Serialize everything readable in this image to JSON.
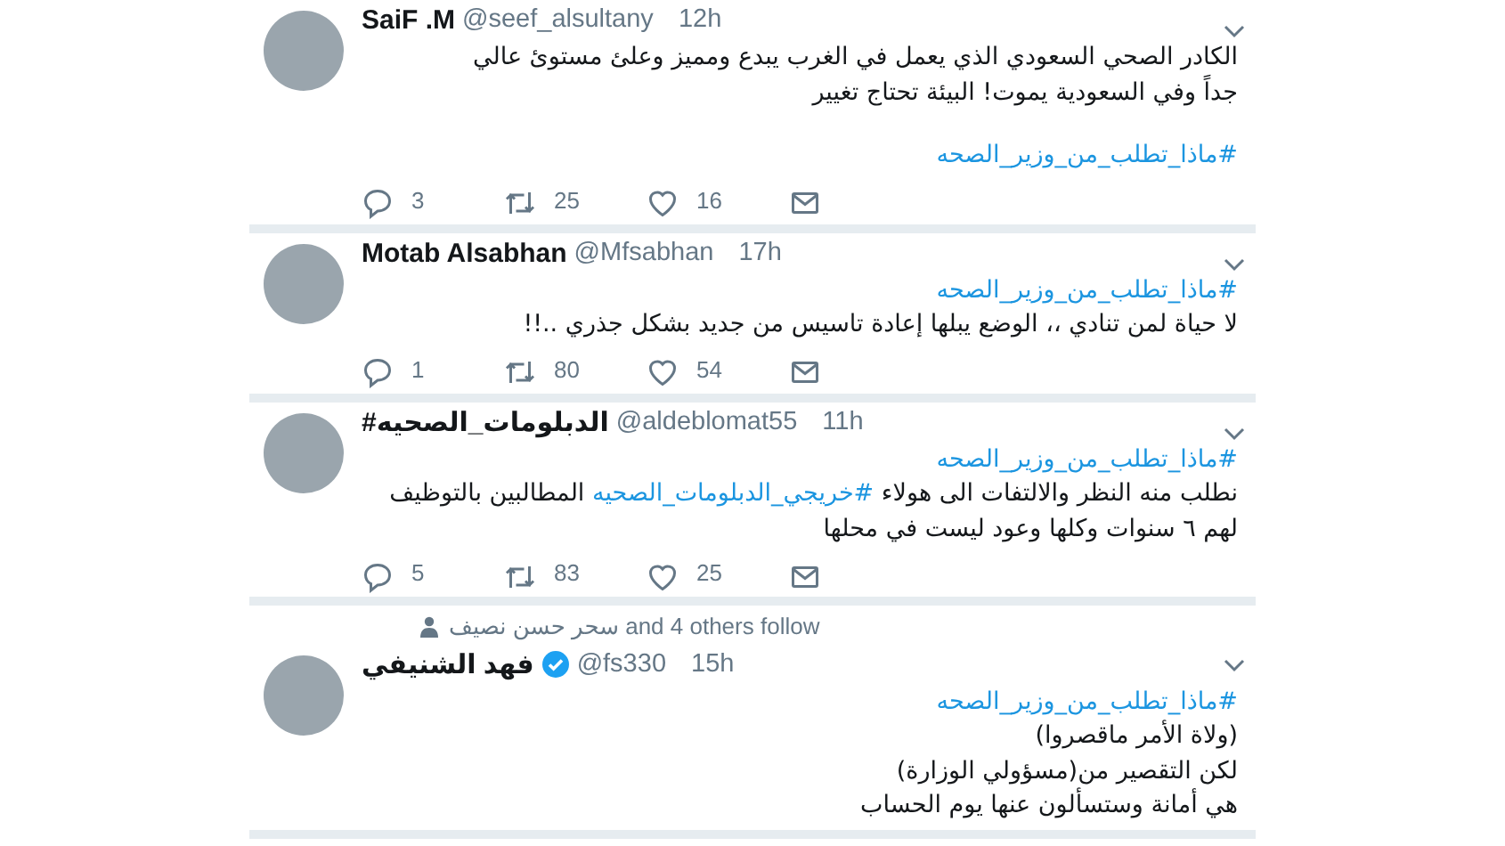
{
  "tweets": [
    {
      "name": "SaiF .M",
      "verified": false,
      "handle": "@seef_alsultany",
      "time": "12h",
      "body": [
        [
          [
            {
              "kind": "text",
              "text": "الكادر الصحي السعودي الذي يعمل في الغرب يبدع ومميز وعلئ مستوئ عالي"
            }
          ],
          [
            {
              "kind": "text",
              "text": "جداً وفي السعودية يموت! البيئة تحتاج تغيير"
            }
          ]
        ],
        [
          [
            {
              "kind": "hashtag",
              "text": "#ماذا_تطلب_من_وزير_الصحه"
            }
          ]
        ]
      ],
      "actions": {
        "replies": "3",
        "retweets": "25",
        "likes": "16"
      }
    },
    {
      "name": "Motab Alsabhan",
      "verified": false,
      "handle": "@Mfsabhan",
      "time": "17h",
      "body": [
        [
          [
            {
              "kind": "hashtag",
              "text": "#ماذا_تطلب_من_وزير_الصحه"
            }
          ],
          [
            {
              "kind": "text",
              "text": "لا حياة لمن تنادي ،، الوضع يبلها إعادة تاسيس من جديد بشكل جذري ..!!"
            }
          ]
        ]
      ],
      "actions": {
        "replies": "1",
        "retweets": "80",
        "likes": "54"
      }
    },
    {
      "name": "#الدبلومات_الصحيه",
      "verified": false,
      "handle": "@aldeblomat55",
      "time": "11h",
      "body": [
        [
          [
            {
              "kind": "hashtag",
              "text": "#ماذا_تطلب_من_وزير_الصحه"
            }
          ],
          [
            {
              "kind": "text",
              "text": "نطلب منه النظر والالتفات الى هولاء "
            },
            {
              "kind": "hashtag",
              "text": "#خريجي_الدبلومات_الصحيه"
            },
            {
              "kind": "text",
              "text": " المطالبين بالتوظيف"
            }
          ],
          [
            {
              "kind": "text",
              "text": "لهم ٦ سنوات وكلها وعود ليست في محلها"
            }
          ]
        ]
      ],
      "actions": {
        "replies": "5",
        "retweets": "83",
        "likes": "25"
      }
    },
    {
      "social_context": "سحر حسن نصيف and 4 others follow",
      "name": "فهد الشنيفي",
      "verified": true,
      "handle": "@fs330",
      "time": "15h",
      "body": [
        [
          [
            {
              "kind": "hashtag",
              "text": "#ماذا_تطلب_من_وزير_الصحه"
            }
          ],
          [
            {
              "kind": "text",
              "text": "(ولاة الأمر ماقصروا)"
            }
          ],
          [
            {
              "kind": "text",
              "text": "لكن التقصير من(مسؤولي الوزارة)"
            }
          ],
          [
            {
              "kind": "text",
              "text": "هي أمانة وستسألون عنها يوم الحساب"
            }
          ]
        ]
      ]
    }
  ]
}
